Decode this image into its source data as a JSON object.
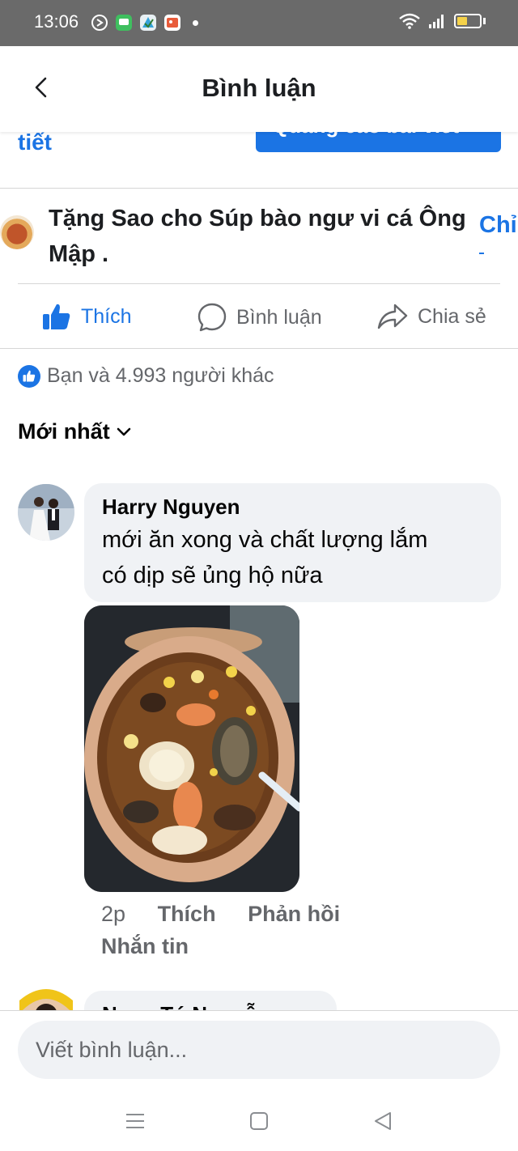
{
  "status_bar": {
    "time": "13:06",
    "app_icons": [
      "navigation-icon",
      "chat-icon",
      "kite-app-icon",
      "photo-app-icon"
    ],
    "battery_color": "#f5d24a"
  },
  "header": {
    "title": "Bình luận",
    "back_icon": "chevron-left-icon"
  },
  "post_cutoff": {
    "link_text": "tiết",
    "button_text": "Quảng cáo bài viết"
  },
  "gift": {
    "text": "Tặng Sao cho Súp bào ngư vi cá Ông Mập .",
    "action_label": "Chỉ"
  },
  "actions": {
    "like": "Thích",
    "comment": "Bình luận",
    "share": "Chia sẻ"
  },
  "likes_summary": "Bạn và 4.993 người khác",
  "sort": {
    "label": "Mới nhất"
  },
  "comment": {
    "author": "Harry Nguyen",
    "text_line1": "mới ăn xong và chất lượng lắm",
    "text_line2": "có dịp sẽ ủng hộ nữa",
    "time": "2p",
    "like": "Thích",
    "reply": "Phản hồi",
    "message": "Nhắn tin"
  },
  "next_comment": {
    "author_partial": "Ngọc Tú Nguyễn"
  },
  "composer": {
    "placeholder": "Viết bình luận..."
  },
  "colors": {
    "accent": "#1b74e4",
    "bubble": "#f0f2f5",
    "secondary_text": "#65676b"
  }
}
